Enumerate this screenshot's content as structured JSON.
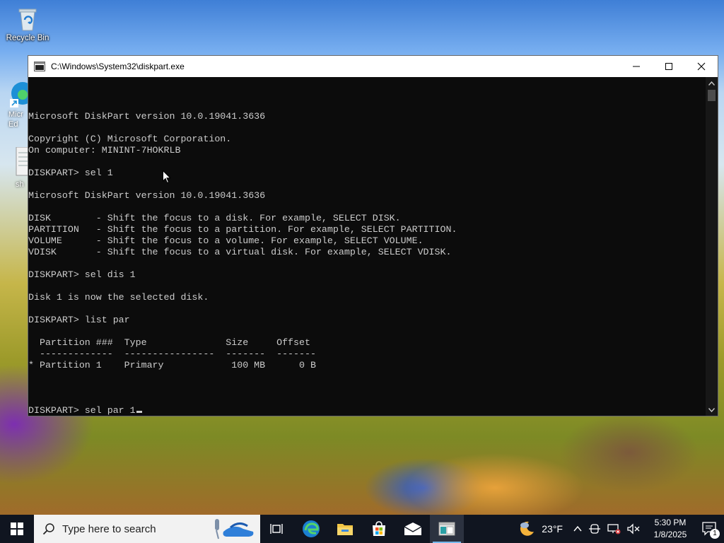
{
  "desktop": {
    "icons": [
      {
        "label": "Recycle Bin",
        "icon": "recycle-bin-icon"
      },
      {
        "label": "Micr\nEd",
        "icon": "edge-icon"
      },
      {
        "label": "sh",
        "icon": "document-icon"
      }
    ]
  },
  "window": {
    "title": "C:\\Windows\\System32\\diskpart.exe",
    "icon": "console-icon",
    "controls": {
      "minimize": "minimize-icon",
      "maximize": "maximize-icon",
      "close": "close-icon"
    }
  },
  "console": {
    "lines": [
      "Microsoft DiskPart version 10.0.19041.3636",
      "",
      "Copyright (C) Microsoft Corporation.",
      "On computer: MININT-7HOKRLB",
      "",
      "DISKPART> sel 1",
      "",
      "Microsoft DiskPart version 10.0.19041.3636",
      "",
      "DISK        - Shift the focus to a disk. For example, SELECT DISK.",
      "PARTITION   - Shift the focus to a partition. For example, SELECT PARTITION.",
      "VOLUME      - Shift the focus to a volume. For example, SELECT VOLUME.",
      "VDISK       - Shift the focus to a virtual disk. For example, SELECT VDISK.",
      "",
      "DISKPART> sel dis 1",
      "",
      "Disk 1 is now the selected disk.",
      "",
      "DISKPART> list par",
      "",
      "  Partition ###  Type              Size     Offset",
      "  -------------  ----------------  -------  -------",
      "* Partition 1    Primary            100 MB      0 B",
      ""
    ],
    "prompt": "DISKPART> sel par 1"
  },
  "taskbar": {
    "search_placeholder": "Type here to search",
    "weather": "23°F",
    "time": "5:30 PM",
    "date": "1/8/2025",
    "notification_count": "1",
    "apps": [
      "task-view-icon",
      "edge-icon",
      "file-explorer-icon",
      "store-icon",
      "mail-icon",
      "diskpart-console-icon"
    ]
  },
  "colors": {
    "console_bg": "#0c0c0c",
    "console_text": "#cccccc",
    "taskbar_bg": "#101520",
    "active_indicator": "#76b9ed"
  }
}
